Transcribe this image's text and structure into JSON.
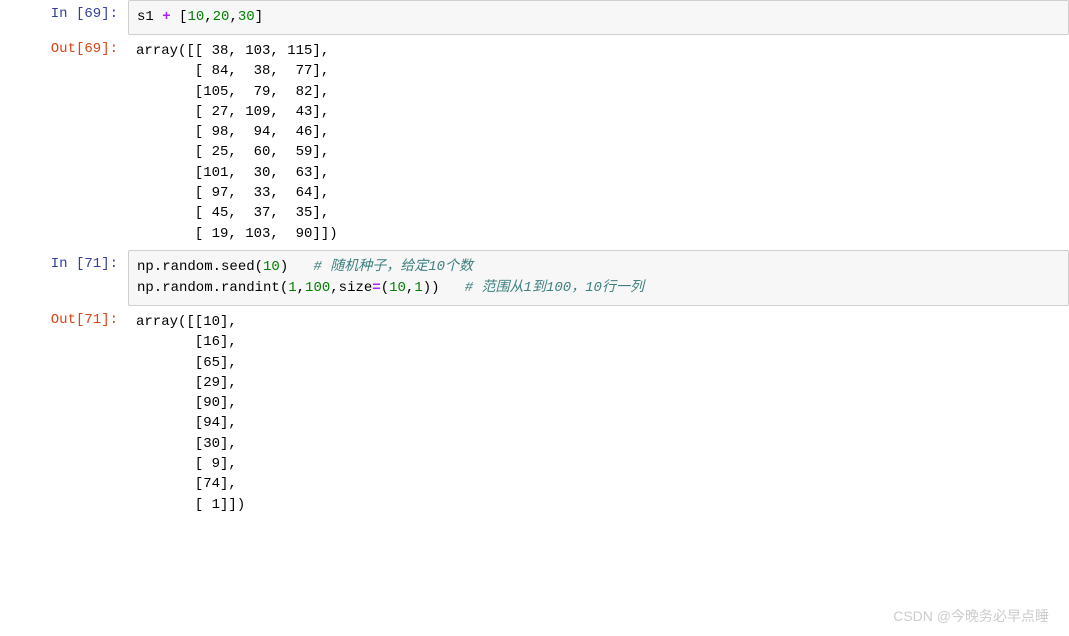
{
  "cells": [
    {
      "type": "in",
      "prompt": "In  [69]:",
      "code_tokens": [
        {
          "t": "s1 ",
          "c": "tok-var"
        },
        {
          "t": "+",
          "c": "tok-op"
        },
        {
          "t": " [",
          "c": "tok-paren"
        },
        {
          "t": "10",
          "c": "tok-num"
        },
        {
          "t": ",",
          "c": "tok-paren"
        },
        {
          "t": "20",
          "c": "tok-num"
        },
        {
          "t": ",",
          "c": "tok-paren"
        },
        {
          "t": "30",
          "c": "tok-num"
        },
        {
          "t": "]",
          "c": "tok-paren"
        }
      ]
    },
    {
      "type": "out",
      "prompt": "Out[69]:",
      "output": "array([[ 38, 103, 115],\n       [ 84,  38,  77],\n       [105,  79,  82],\n       [ 27, 109,  43],\n       [ 98,  94,  46],\n       [ 25,  60,  59],\n       [101,  30,  63],\n       [ 97,  33,  64],\n       [ 45,  37,  35],\n       [ 19, 103,  90]])"
    },
    {
      "type": "in",
      "prompt": "In  [71]:",
      "code_tokens": [
        {
          "t": "np.random.seed(",
          "c": "tok-func"
        },
        {
          "t": "10",
          "c": "tok-num"
        },
        {
          "t": ")   ",
          "c": "tok-func"
        },
        {
          "t": "# 随机种子，给定10个数",
          "c": "tok-comment"
        },
        {
          "t": "\n",
          "c": ""
        },
        {
          "t": "np.random.randint(",
          "c": "tok-func"
        },
        {
          "t": "1",
          "c": "tok-num"
        },
        {
          "t": ",",
          "c": "tok-paren"
        },
        {
          "t": "100",
          "c": "tok-num"
        },
        {
          "t": ",size",
          "c": "tok-func"
        },
        {
          "t": "=",
          "c": "tok-op"
        },
        {
          "t": "(",
          "c": "tok-paren"
        },
        {
          "t": "10",
          "c": "tok-num"
        },
        {
          "t": ",",
          "c": "tok-paren"
        },
        {
          "t": "1",
          "c": "tok-num"
        },
        {
          "t": "))   ",
          "c": "tok-paren"
        },
        {
          "t": "# 范围从1到100，10行一列",
          "c": "tok-comment"
        }
      ]
    },
    {
      "type": "out",
      "prompt": "Out[71]:",
      "output": "array([[10],\n       [16],\n       [65],\n       [29],\n       [90],\n       [94],\n       [30],\n       [ 9],\n       [74],\n       [ 1]])"
    }
  ],
  "watermark": "CSDN @今晚务必早点睡"
}
